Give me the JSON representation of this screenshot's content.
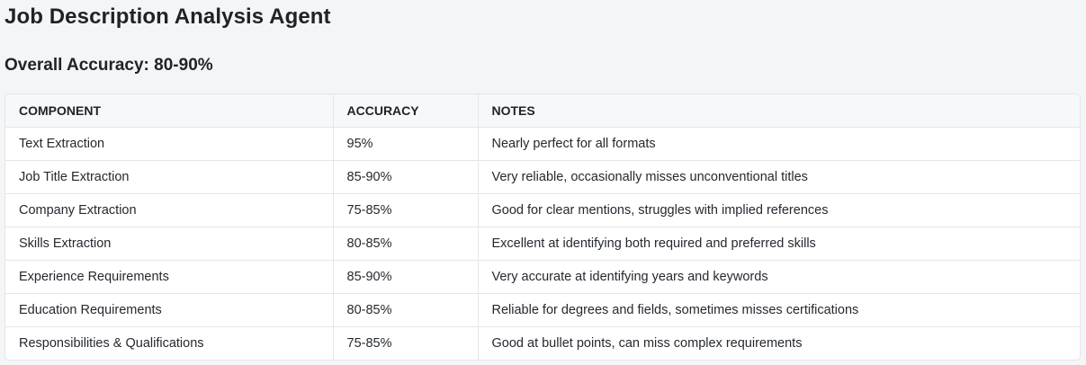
{
  "title": "Job Description Analysis Agent",
  "overall": "Overall Accuracy: 80-90%",
  "table": {
    "headers": [
      "COMPONENT",
      "ACCURACY",
      "NOTES"
    ],
    "rows": [
      {
        "component": "Text Extraction",
        "accuracy": "95%",
        "notes": "Nearly perfect for all formats"
      },
      {
        "component": "Job Title Extraction",
        "accuracy": "85-90%",
        "notes": "Very reliable, occasionally misses unconventional titles"
      },
      {
        "component": "Company Extraction",
        "accuracy": "75-85%",
        "notes": "Good for clear mentions, struggles with implied references"
      },
      {
        "component": "Skills Extraction",
        "accuracy": "80-85%",
        "notes": "Excellent at identifying both required and preferred skills"
      },
      {
        "component": "Experience Requirements",
        "accuracy": "85-90%",
        "notes": "Very accurate at identifying years and keywords"
      },
      {
        "component": "Education Requirements",
        "accuracy": "80-85%",
        "notes": "Reliable for degrees and fields, sometimes misses certifications"
      },
      {
        "component": "Responsibilities & Qualifications",
        "accuracy": "75-85%",
        "notes": "Good at bullet points, can miss complex requirements"
      }
    ]
  }
}
